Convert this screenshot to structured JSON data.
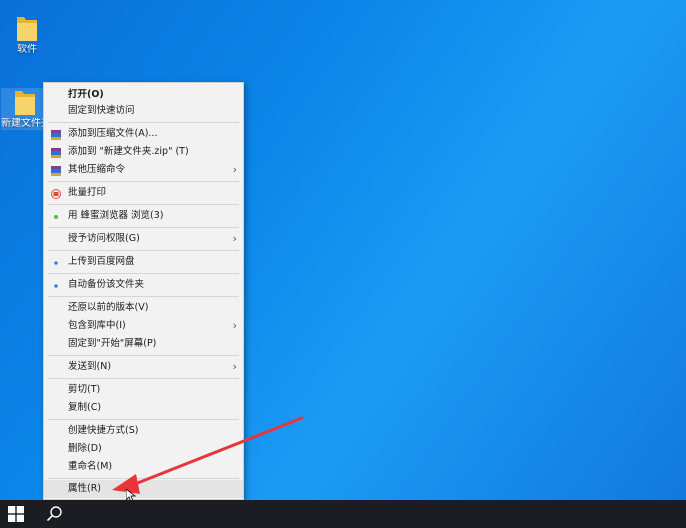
{
  "desktop": {
    "icons": [
      {
        "label": "软件"
      },
      {
        "label": "新建文件夹"
      }
    ]
  },
  "menu": {
    "items": {
      "open": "打开(O)",
      "pin_quick": "固定到快速访问",
      "add_archive": "添加到压缩文件(A)...",
      "add_zip": "添加到 \"新建文件夹.zip\" (T)",
      "other_compress": "其他压缩命令",
      "batch_print": "批量打印",
      "browser": "用 蜂蜜浏览器 浏览(3)",
      "grant_access": "授予访问权限(G)",
      "upload_baidu": "上传到百度网盘",
      "auto_backup": "自动备份该文件夹",
      "restore": "还原以前的版本(V)",
      "include_lib": "包含到库中(I)",
      "pin_start": "固定到\"开始\"屏幕(P)",
      "send_to": "发送到(N)",
      "cut": "剪切(T)",
      "copy": "复制(C)",
      "shortcut": "创建快捷方式(S)",
      "delete": "删除(D)",
      "rename": "重命名(M)",
      "properties": "属性(R)"
    },
    "submenu_arrow": "›"
  },
  "colors": {
    "desktop": "#0b86ea",
    "taskbar": "#1c1d22",
    "annotation_arrow": "#e8353a"
  }
}
